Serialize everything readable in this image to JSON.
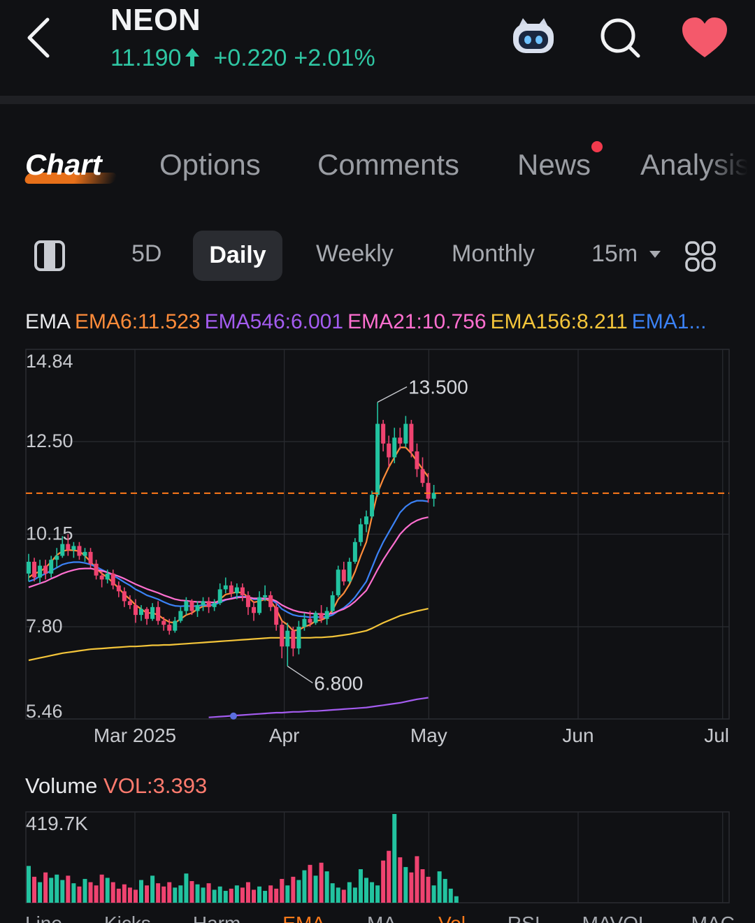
{
  "header": {
    "ticker": "NEON",
    "price": "11.190",
    "change": "+0.220",
    "change_pct": "+2.01%",
    "colors": {
      "up": "#2fc6a3",
      "favorite": "#f4596b"
    },
    "icons": [
      "back-arrow-icon",
      "robot-assistant-icon",
      "search-icon",
      "heart-icon",
      "price-up-arrow-icon"
    ]
  },
  "tabs": [
    {
      "label": "Chart",
      "active": true
    },
    {
      "label": "Options"
    },
    {
      "label": "Comments"
    },
    {
      "label": "News",
      "has_notification": true
    },
    {
      "label": "Analysis"
    }
  ],
  "periods": {
    "items": [
      "5D",
      "Daily",
      "Weekly",
      "Monthly"
    ],
    "selected": "Daily",
    "interval": "15m",
    "icons": [
      "layout-toggle-icon",
      "caret-down-icon",
      "grid-icon"
    ]
  },
  "ema_legend": {
    "name": "EMA",
    "items": [
      {
        "label": "EMA6:11.523",
        "color": "#ff8c3a"
      },
      {
        "label": "EMA546:6.001",
        "color": "#a45cf0"
      },
      {
        "label": "EMA21:10.756",
        "color": "#ff6fd0"
      },
      {
        "label": "EMA156:8.211",
        "color": "#f4c53a"
      },
      {
        "label": "EMA1...",
        "color": "#3b82f6"
      }
    ]
  },
  "chart_data": {
    "type": "candlestick",
    "y_ticks": [
      "14.84",
      "12.50",
      "10.15",
      "7.80",
      "5.46"
    ],
    "ylim": [
      5.46,
      14.84
    ],
    "x_ticks": [
      "Mar 2025",
      "Apr",
      "May",
      "Jun",
      "Jul"
    ],
    "current_price_line": 11.19,
    "annotations": {
      "high": "13.500",
      "low": "6.800"
    },
    "candles": [
      {
        "o": 9.15,
        "h": 9.65,
        "l": 8.95,
        "c": 9.45
      },
      {
        "o": 9.45,
        "h": 9.55,
        "l": 8.95,
        "c": 9.05
      },
      {
        "o": 9.05,
        "h": 9.5,
        "l": 8.9,
        "c": 9.35
      },
      {
        "o": 9.35,
        "h": 9.5,
        "l": 9.0,
        "c": 9.15
      },
      {
        "o": 9.15,
        "h": 9.6,
        "l": 9.05,
        "c": 9.5
      },
      {
        "o": 9.5,
        "h": 9.8,
        "l": 9.3,
        "c": 9.6
      },
      {
        "o": 9.6,
        "h": 10.1,
        "l": 9.55,
        "c": 9.9
      },
      {
        "o": 9.9,
        "h": 10.15,
        "l": 9.6,
        "c": 9.75
      },
      {
        "o": 9.75,
        "h": 9.95,
        "l": 9.55,
        "c": 9.85
      },
      {
        "o": 9.85,
        "h": 9.95,
        "l": 9.5,
        "c": 9.6
      },
      {
        "o": 9.6,
        "h": 9.8,
        "l": 9.45,
        "c": 9.7
      },
      {
        "o": 9.7,
        "h": 9.8,
        "l": 9.3,
        "c": 9.4
      },
      {
        "o": 9.4,
        "h": 9.5,
        "l": 9.0,
        "c": 9.1
      },
      {
        "o": 9.1,
        "h": 9.2,
        "l": 8.8,
        "c": 9.0
      },
      {
        "o": 9.0,
        "h": 9.25,
        "l": 8.9,
        "c": 9.15
      },
      {
        "o": 9.15,
        "h": 9.25,
        "l": 8.75,
        "c": 8.85
      },
      {
        "o": 8.85,
        "h": 8.95,
        "l": 8.55,
        "c": 8.7
      },
      {
        "o": 8.7,
        "h": 8.8,
        "l": 8.3,
        "c": 8.45
      },
      {
        "o": 8.45,
        "h": 8.6,
        "l": 8.25,
        "c": 8.35
      },
      {
        "o": 8.35,
        "h": 8.5,
        "l": 7.9,
        "c": 8.1
      },
      {
        "o": 8.1,
        "h": 8.35,
        "l": 7.95,
        "c": 8.25
      },
      {
        "o": 8.25,
        "h": 8.3,
        "l": 7.85,
        "c": 8.0
      },
      {
        "o": 8.0,
        "h": 8.4,
        "l": 7.95,
        "c": 8.3
      },
      {
        "o": 8.3,
        "h": 8.45,
        "l": 7.85,
        "c": 7.95
      },
      {
        "o": 7.95,
        "h": 8.05,
        "l": 7.7,
        "c": 7.85
      },
      {
        "o": 7.85,
        "h": 8.0,
        "l": 7.6,
        "c": 7.7
      },
      {
        "o": 7.7,
        "h": 8.05,
        "l": 7.65,
        "c": 7.95
      },
      {
        "o": 7.95,
        "h": 8.3,
        "l": 7.9,
        "c": 8.2
      },
      {
        "o": 8.2,
        "h": 8.55,
        "l": 8.1,
        "c": 8.45
      },
      {
        "o": 8.45,
        "h": 8.5,
        "l": 8.1,
        "c": 8.2
      },
      {
        "o": 8.2,
        "h": 8.45,
        "l": 8.05,
        "c": 8.35
      },
      {
        "o": 8.35,
        "h": 8.55,
        "l": 8.2,
        "c": 8.45
      },
      {
        "o": 8.45,
        "h": 8.55,
        "l": 8.15,
        "c": 8.3
      },
      {
        "o": 8.3,
        "h": 8.5,
        "l": 8.2,
        "c": 8.4
      },
      {
        "o": 8.4,
        "h": 8.9,
        "l": 8.35,
        "c": 8.75
      },
      {
        "o": 8.75,
        "h": 9.05,
        "l": 8.65,
        "c": 8.85
      },
      {
        "o": 8.85,
        "h": 8.95,
        "l": 8.55,
        "c": 8.65
      },
      {
        "o": 8.65,
        "h": 8.9,
        "l": 8.5,
        "c": 8.8
      },
      {
        "o": 8.8,
        "h": 8.9,
        "l": 8.45,
        "c": 8.6
      },
      {
        "o": 8.6,
        "h": 8.7,
        "l": 8.1,
        "c": 8.3
      },
      {
        "o": 8.3,
        "h": 8.45,
        "l": 7.95,
        "c": 8.15
      },
      {
        "o": 8.15,
        "h": 8.7,
        "l": 8.1,
        "c": 8.55
      },
      {
        "o": 8.55,
        "h": 8.85,
        "l": 8.45,
        "c": 8.6
      },
      {
        "o": 8.6,
        "h": 8.7,
        "l": 8.2,
        "c": 8.3
      },
      {
        "o": 8.3,
        "h": 8.4,
        "l": 7.7,
        "c": 7.85
      },
      {
        "o": 7.85,
        "h": 7.95,
        "l": 7.0,
        "c": 7.3
      },
      {
        "o": 7.3,
        "h": 7.9,
        "l": 6.8,
        "c": 7.7
      },
      {
        "o": 7.7,
        "h": 7.8,
        "l": 7.05,
        "c": 7.25
      },
      {
        "o": 7.25,
        "h": 7.95,
        "l": 7.1,
        "c": 7.8
      },
      {
        "o": 7.8,
        "h": 8.15,
        "l": 7.7,
        "c": 8.0
      },
      {
        "o": 8.0,
        "h": 8.2,
        "l": 7.8,
        "c": 7.9
      },
      {
        "o": 7.9,
        "h": 8.2,
        "l": 7.85,
        "c": 8.15
      },
      {
        "o": 8.15,
        "h": 8.35,
        "l": 7.9,
        "c": 8.0
      },
      {
        "o": 8.0,
        "h": 8.3,
        "l": 7.85,
        "c": 8.2
      },
      {
        "o": 8.2,
        "h": 8.7,
        "l": 8.15,
        "c": 8.6
      },
      {
        "o": 8.6,
        "h": 9.35,
        "l": 8.55,
        "c": 9.25
      },
      {
        "o": 9.25,
        "h": 9.45,
        "l": 8.85,
        "c": 8.95
      },
      {
        "o": 8.95,
        "h": 9.55,
        "l": 8.9,
        "c": 9.45
      },
      {
        "o": 9.45,
        "h": 10.05,
        "l": 9.4,
        "c": 9.95
      },
      {
        "o": 9.95,
        "h": 10.55,
        "l": 9.85,
        "c": 10.4
      },
      {
        "o": 10.4,
        "h": 10.75,
        "l": 10.2,
        "c": 10.6
      },
      {
        "o": 10.6,
        "h": 11.25,
        "l": 10.55,
        "c": 11.15
      },
      {
        "o": 11.15,
        "h": 13.5,
        "l": 11.1,
        "c": 12.95
      },
      {
        "o": 12.95,
        "h": 13.05,
        "l": 12.25,
        "c": 12.45
      },
      {
        "o": 12.45,
        "h": 12.65,
        "l": 11.85,
        "c": 12.1
      },
      {
        "o": 12.1,
        "h": 12.85,
        "l": 11.95,
        "c": 12.6
      },
      {
        "o": 12.6,
        "h": 12.85,
        "l": 12.3,
        "c": 12.45
      },
      {
        "o": 12.45,
        "h": 13.15,
        "l": 12.35,
        "c": 12.95
      },
      {
        "o": 12.95,
        "h": 13.05,
        "l": 12.1,
        "c": 12.25
      },
      {
        "o": 12.25,
        "h": 12.45,
        "l": 11.6,
        "c": 11.8
      },
      {
        "o": 11.8,
        "h": 12.1,
        "l": 11.35,
        "c": 11.45
      },
      {
        "o": 11.45,
        "h": 11.7,
        "l": 10.95,
        "c": 11.05
      },
      {
        "o": 11.05,
        "h": 11.4,
        "l": 10.85,
        "c": 11.2
      }
    ],
    "start_day_offset": -40,
    "date_markers": {
      "Mar 2025": 0,
      "Apr": 31,
      "May": 61,
      "Jun": 92,
      "Jul": 122
    },
    "ema_series": [
      {
        "name": "EMA6",
        "color": "#ff8c3a",
        "values": [
          9.05,
          9.15,
          9.2,
          9.3,
          9.45,
          9.62,
          9.72,
          9.75,
          9.74,
          9.72,
          9.6,
          9.45,
          9.28,
          9.15,
          9.05,
          8.92,
          8.78,
          8.62,
          8.5,
          8.35,
          8.25,
          8.15,
          8.15,
          8.1,
          8.0,
          7.92,
          7.9,
          8.0,
          8.1,
          8.15,
          8.25,
          8.32,
          8.33,
          8.36,
          8.5,
          8.62,
          8.65,
          8.68,
          8.66,
          8.55,
          8.42,
          8.45,
          8.5,
          8.45,
          8.25,
          7.95,
          7.85,
          7.7,
          7.72,
          7.8,
          7.85,
          7.95,
          7.97,
          8.04,
          8.22,
          8.5,
          8.65,
          8.88,
          9.2,
          9.6,
          9.95,
          10.6,
          11.2,
          11.55,
          11.85,
          12.1,
          12.35,
          12.35,
          12.2,
          12.0,
          11.8,
          11.6
        ]
      },
      {
        "name": "EMA1",
        "color": "#3b82f6",
        "values": [
          8.95,
          9.0,
          9.08,
          9.15,
          9.22,
          9.3,
          9.38,
          9.42,
          9.44,
          9.44,
          9.42,
          9.38,
          9.32,
          9.25,
          9.18,
          9.1,
          9.02,
          8.93,
          8.85,
          8.75,
          8.68,
          8.6,
          8.55,
          8.5,
          8.43,
          8.37,
          8.33,
          8.32,
          8.33,
          8.32,
          8.33,
          8.35,
          8.35,
          8.36,
          8.42,
          8.48,
          8.52,
          8.56,
          8.57,
          8.55,
          8.5,
          8.5,
          8.51,
          8.5,
          8.4,
          8.25,
          8.17,
          8.1,
          8.07,
          8.06,
          8.04,
          8.05,
          8.04,
          8.05,
          8.1,
          8.2,
          8.28,
          8.4,
          8.55,
          8.75,
          8.95,
          9.3,
          9.65,
          9.95,
          10.2,
          10.45,
          10.7,
          10.85,
          10.95,
          11.0,
          11.0,
          10.98
        ]
      },
      {
        "name": "EMA21",
        "color": "#ff6fd0",
        "values": [
          8.8,
          8.85,
          8.9,
          8.95,
          9.02,
          9.08,
          9.15,
          9.2,
          9.24,
          9.27,
          9.28,
          9.28,
          9.25,
          9.22,
          9.18,
          9.13,
          9.08,
          9.02,
          8.95,
          8.88,
          8.82,
          8.76,
          8.71,
          8.66,
          8.6,
          8.55,
          8.5,
          8.47,
          8.46,
          8.44,
          8.43,
          8.43,
          8.42,
          8.42,
          8.45,
          8.49,
          8.51,
          8.54,
          8.55,
          8.55,
          8.52,
          8.52,
          8.52,
          8.51,
          8.45,
          8.35,
          8.28,
          8.22,
          8.18,
          8.16,
          8.14,
          8.13,
          8.12,
          8.12,
          8.14,
          8.2,
          8.25,
          8.33,
          8.44,
          8.58,
          8.72,
          8.98,
          9.25,
          9.5,
          9.72,
          9.93,
          10.15,
          10.3,
          10.42,
          10.5,
          10.55,
          10.58
        ]
      },
      {
        "name": "EMA156",
        "color": "#f4c53a",
        "values": [
          6.95,
          6.98,
          7.01,
          7.04,
          7.07,
          7.1,
          7.13,
          7.15,
          7.17,
          7.19,
          7.21,
          7.23,
          7.24,
          7.25,
          7.26,
          7.27,
          7.28,
          7.29,
          7.3,
          7.3,
          7.31,
          7.32,
          7.33,
          7.33,
          7.34,
          7.34,
          7.35,
          7.36,
          7.37,
          7.38,
          7.39,
          7.4,
          7.41,
          7.42,
          7.43,
          7.44,
          7.45,
          7.46,
          7.47,
          7.48,
          7.49,
          7.5,
          7.51,
          7.52,
          7.52,
          7.52,
          7.52,
          7.52,
          7.52,
          7.52,
          7.52,
          7.53,
          7.53,
          7.54,
          7.55,
          7.57,
          7.59,
          7.61,
          7.64,
          7.67,
          7.7,
          7.76,
          7.83,
          7.9,
          7.96,
          8.02,
          8.08,
          8.12,
          8.16,
          8.2,
          8.23,
          8.26
        ]
      },
      {
        "name": "EMA546",
        "color": "#a45cf0",
        "values": [
          null,
          null,
          null,
          null,
          null,
          null,
          null,
          null,
          null,
          null,
          null,
          null,
          null,
          null,
          null,
          null,
          null,
          null,
          null,
          null,
          null,
          null,
          null,
          null,
          null,
          null,
          null,
          null,
          null,
          null,
          null,
          null,
          5.5,
          5.51,
          5.52,
          5.53,
          5.54,
          5.55,
          5.56,
          5.57,
          5.58,
          5.59,
          5.6,
          5.61,
          5.62,
          5.62,
          5.63,
          5.64,
          5.64,
          5.65,
          5.66,
          5.66,
          5.67,
          5.68,
          5.69,
          5.7,
          5.71,
          5.72,
          5.73,
          5.74,
          5.75,
          5.77,
          5.79,
          5.81,
          5.83,
          5.85,
          5.87,
          5.9,
          5.93,
          5.96,
          5.98,
          6.0
        ]
      }
    ],
    "colors": {
      "up": "#22c3a0",
      "down": "#ef4370",
      "price_line": "#ff7a1a",
      "grid": "#2a2c31",
      "axis_text": "#c7c9ce"
    }
  },
  "volume_legend": {
    "name": "Volume",
    "label": "VOL:3.393",
    "color": "#ff7b6e"
  },
  "volume_chart_data": {
    "type": "bar",
    "ymax_label": "419.7K",
    "ymax": 419700,
    "values": [
      170000,
      120000,
      95000,
      140000,
      115000,
      130000,
      105000,
      125000,
      90000,
      75000,
      110000,
      95000,
      80000,
      130000,
      115000,
      95000,
      65000,
      85000,
      70000,
      60000,
      105000,
      80000,
      125000,
      90000,
      75000,
      95000,
      70000,
      80000,
      135000,
      100000,
      85000,
      70000,
      90000,
      60000,
      75000,
      55000,
      65000,
      80000,
      70000,
      95000,
      60000,
      75000,
      55000,
      80000,
      65000,
      110000,
      80000,
      120000,
      105000,
      150000,
      175000,
      125000,
      185000,
      145000,
      90000,
      70000,
      60000,
      95000,
      70000,
      155000,
      115000,
      95000,
      80000,
      195000,
      240000,
      410000,
      210000,
      165000,
      140000,
      215000,
      155000,
      120000,
      80000,
      145000,
      110000,
      65000,
      30000
    ]
  },
  "bottom_indicators": [
    "Line",
    "Kicks",
    "Harm",
    "EMA",
    "MA",
    "Vol",
    "RSI",
    "MAVOL",
    "MAC"
  ]
}
